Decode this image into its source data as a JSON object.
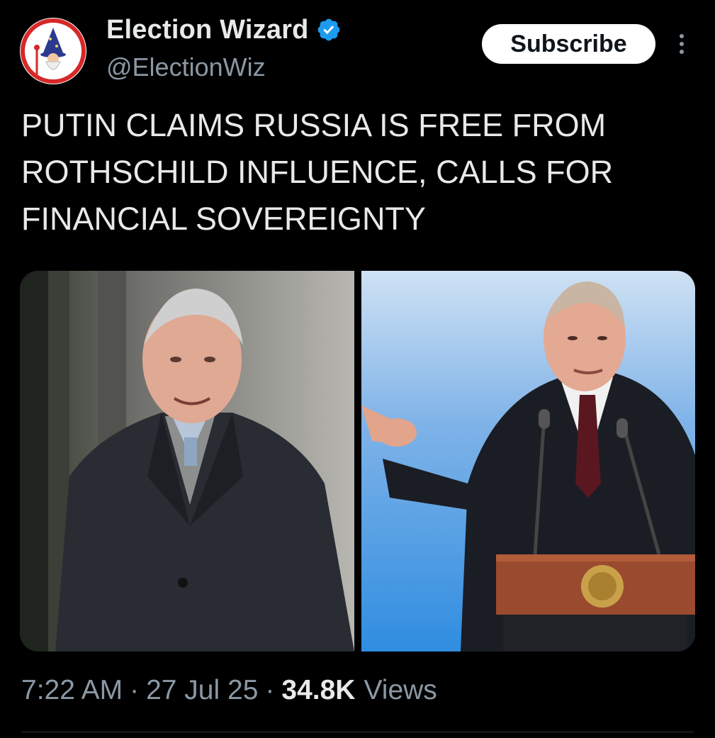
{
  "author": {
    "name": "Election Wizard",
    "handle": "@ElectionWiz",
    "verified": true,
    "avatar_icon": "wizard-avatar-icon"
  },
  "actions": {
    "subscribe_label": "Subscribe",
    "more_icon": "more-vertical-icon"
  },
  "tweet": {
    "text": "PUTIN CLAIMS RUSSIA IS FREE FROM\nROTHSCHILD INFLUENCE, CALLS FOR\nFINANCIAL SOVEREIGNTY"
  },
  "meta": {
    "time": "7:22 AM",
    "date": "27 Jul 25",
    "separator": "·",
    "views_count": "34.8K",
    "views_label": "Views"
  },
  "colors": {
    "background": "#000000",
    "text_primary": "#e7e9ea",
    "text_secondary": "#8b98a5",
    "verified_blue": "#1d9bf0"
  }
}
